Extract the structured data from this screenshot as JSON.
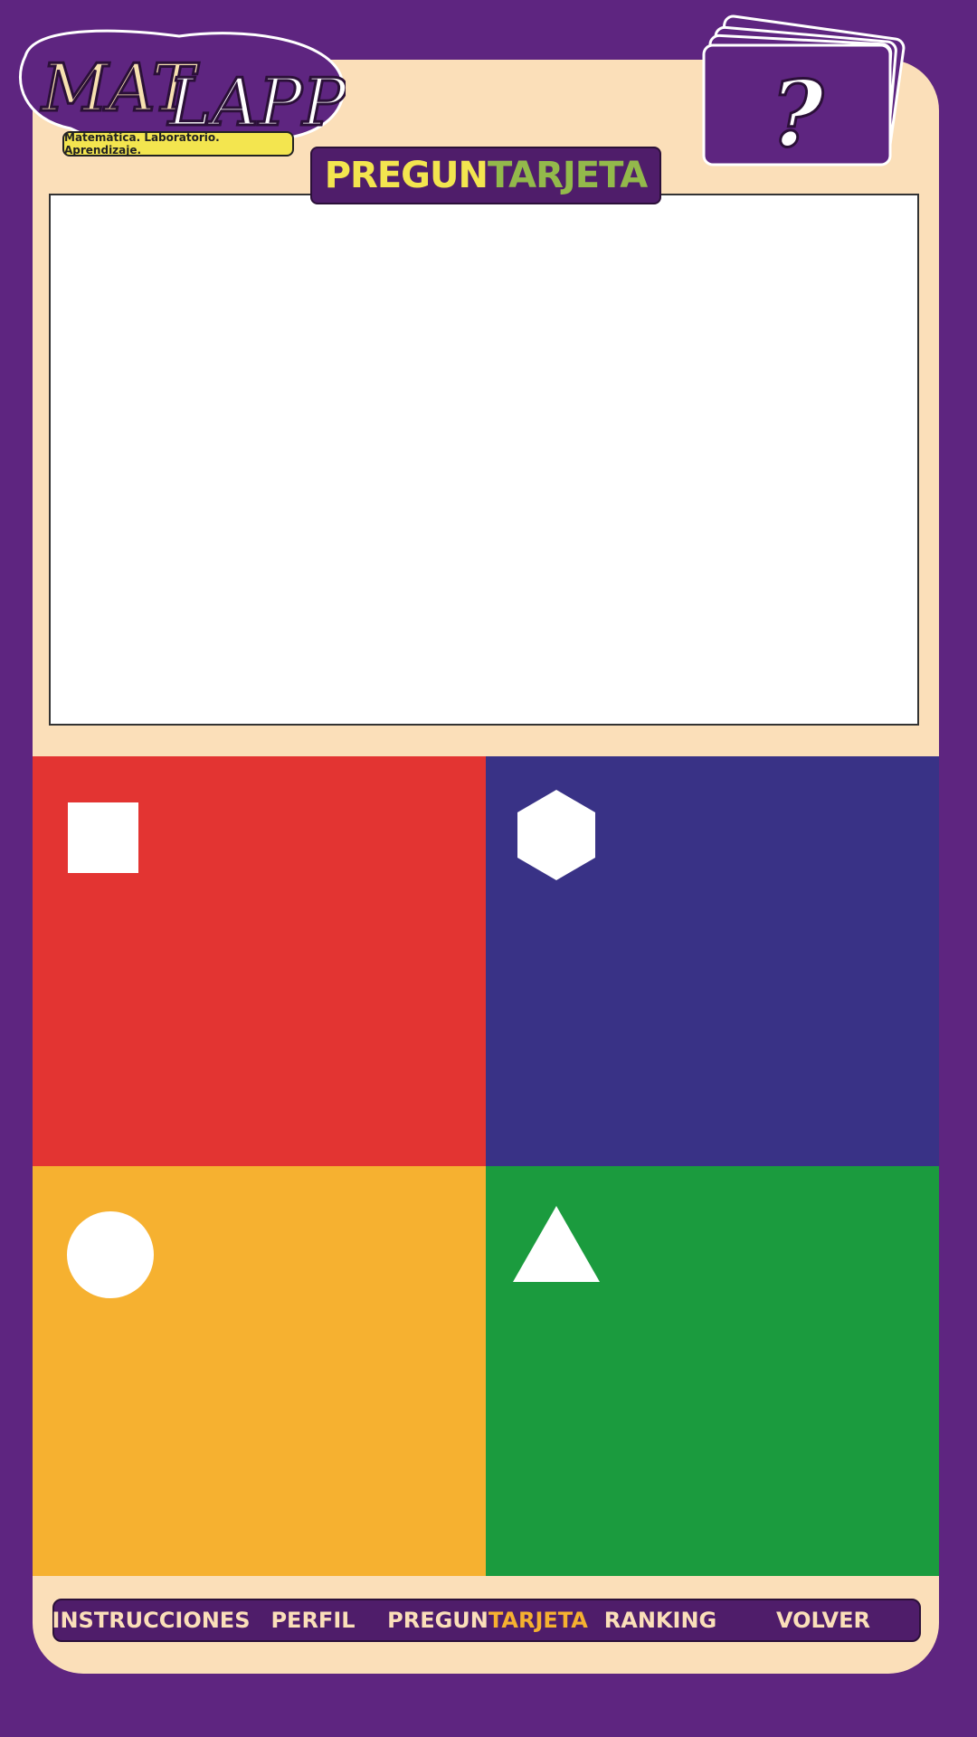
{
  "brand": {
    "logo_text_left": "MAT",
    "logo_text_right": "LAPP",
    "tagline": "Matemática. Laboratorio. Aprendizaje."
  },
  "title": {
    "part1": "PREGUN",
    "part2": "TARJETA"
  },
  "question_card_icon": {
    "icon": "question-mark-cards-icon",
    "glyph": "?"
  },
  "question": {
    "text": ""
  },
  "answers": [
    {
      "color": "#e33432",
      "shape": "square-icon"
    },
    {
      "color": "#393286",
      "shape": "hexagon-icon"
    },
    {
      "color": "#f6b130",
      "shape": "circle-icon"
    },
    {
      "color": "#1b9b3e",
      "shape": "triangle-icon"
    }
  ],
  "nav": {
    "instrucciones": "INSTRUCCIONES",
    "perfil": "PERFIL",
    "preguntarjeta_part1": "PREGUN",
    "preguntarjeta_part2": "TARJETA",
    "ranking": "RANKING",
    "volver": "VOLVER"
  },
  "colors": {
    "background": "#5e2580",
    "card": "#fbdfb9",
    "yellow": "#f3e54f",
    "green": "#93b94b",
    "orange": "#f6b130"
  }
}
